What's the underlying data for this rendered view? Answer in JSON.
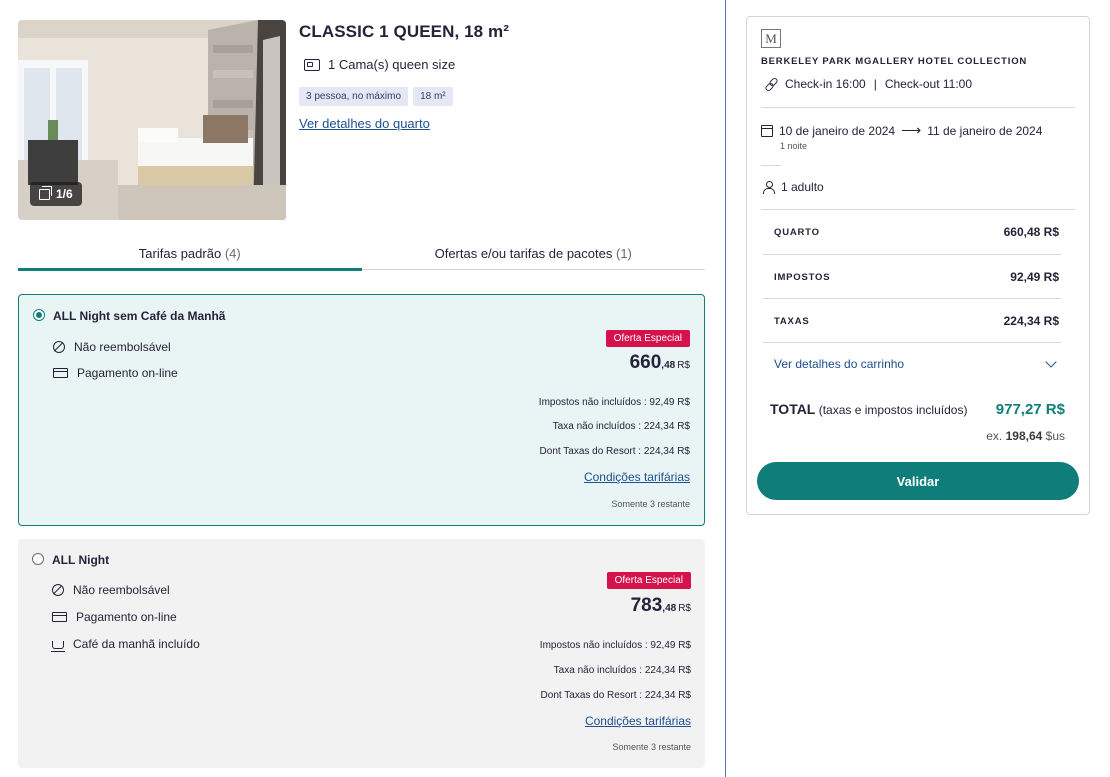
{
  "room": {
    "title": "CLASSIC 1 QUEEN, 18 m²",
    "bed": "1 Cama(s) queen size",
    "tags": [
      "3 pessoa, no máximo",
      "18 m²"
    ],
    "details_link": "Ver detalhes do quarto",
    "photo_counter": "1/6"
  },
  "tabs": [
    {
      "label": "Tarifas padrão",
      "count": "(4)",
      "active": true
    },
    {
      "label": "Ofertas e/ou tarifas de pacotes",
      "count": "(1)",
      "active": false
    }
  ],
  "rates": [
    {
      "name": "ALL Night sem Café da Manhã",
      "selected": true,
      "features": [
        "Não reembolsável",
        "Pagamento on-line"
      ],
      "badge": "Oferta Especial",
      "price_int": "660",
      "price_cents": ",48",
      "currency": "R$",
      "taxes": [
        "Impostos não incluídos : 92,49 R$",
        "Taxa não incluídos : 224,34 R$",
        "Dont Taxas do Resort : 224,34 R$"
      ],
      "conditions": "Condições tarifárias",
      "remaining": "Somente 3 restante"
    },
    {
      "name": "ALL Night",
      "selected": false,
      "features": [
        "Não reembolsável",
        "Pagamento on-line",
        "Café da manhã incluído"
      ],
      "badge": "Oferta Especial",
      "price_int": "783",
      "price_cents": ",48",
      "currency": "R$",
      "taxes": [
        "Impostos não incluídos : 92,49 R$",
        "Taxa não incluídos : 224,34 R$",
        "Dont Taxas do Resort : 224,34 R$"
      ],
      "conditions": "Condições tarifárias",
      "remaining": "Somente 3 restante"
    }
  ],
  "summary": {
    "hotel_logo": "M",
    "hotel_name": "BERKELEY PARK MGALLERY HOTEL COLLECTION",
    "checkin": "Check-in 16:00",
    "separator": "|",
    "checkout": "Check-out 11:00",
    "date_from": "10 de janeiro de 2024",
    "date_to": "11 de janeiro de 2024",
    "nights": "1 noite",
    "guests": "1 adulto",
    "lines": [
      {
        "label": "QUARTO",
        "value": "660,48 R$"
      },
      {
        "label": "IMPOSTOS",
        "value": "92,49 R$"
      },
      {
        "label": "TAXAS",
        "value": "224,34 R$"
      }
    ],
    "cart_link": "Ver detalhes do carrinho",
    "total_label": "TOTAL",
    "total_sub": "(taxas e impostos incluídos)",
    "total_value": "977,27 R$",
    "usd_prefix": "ex.",
    "usd_value": "198,64",
    "usd_suffix": "$us",
    "validate": "Validar"
  },
  "colors": {
    "accent": "#0f7e7a",
    "badge": "#d6124d",
    "link": "#1d4f91"
  }
}
